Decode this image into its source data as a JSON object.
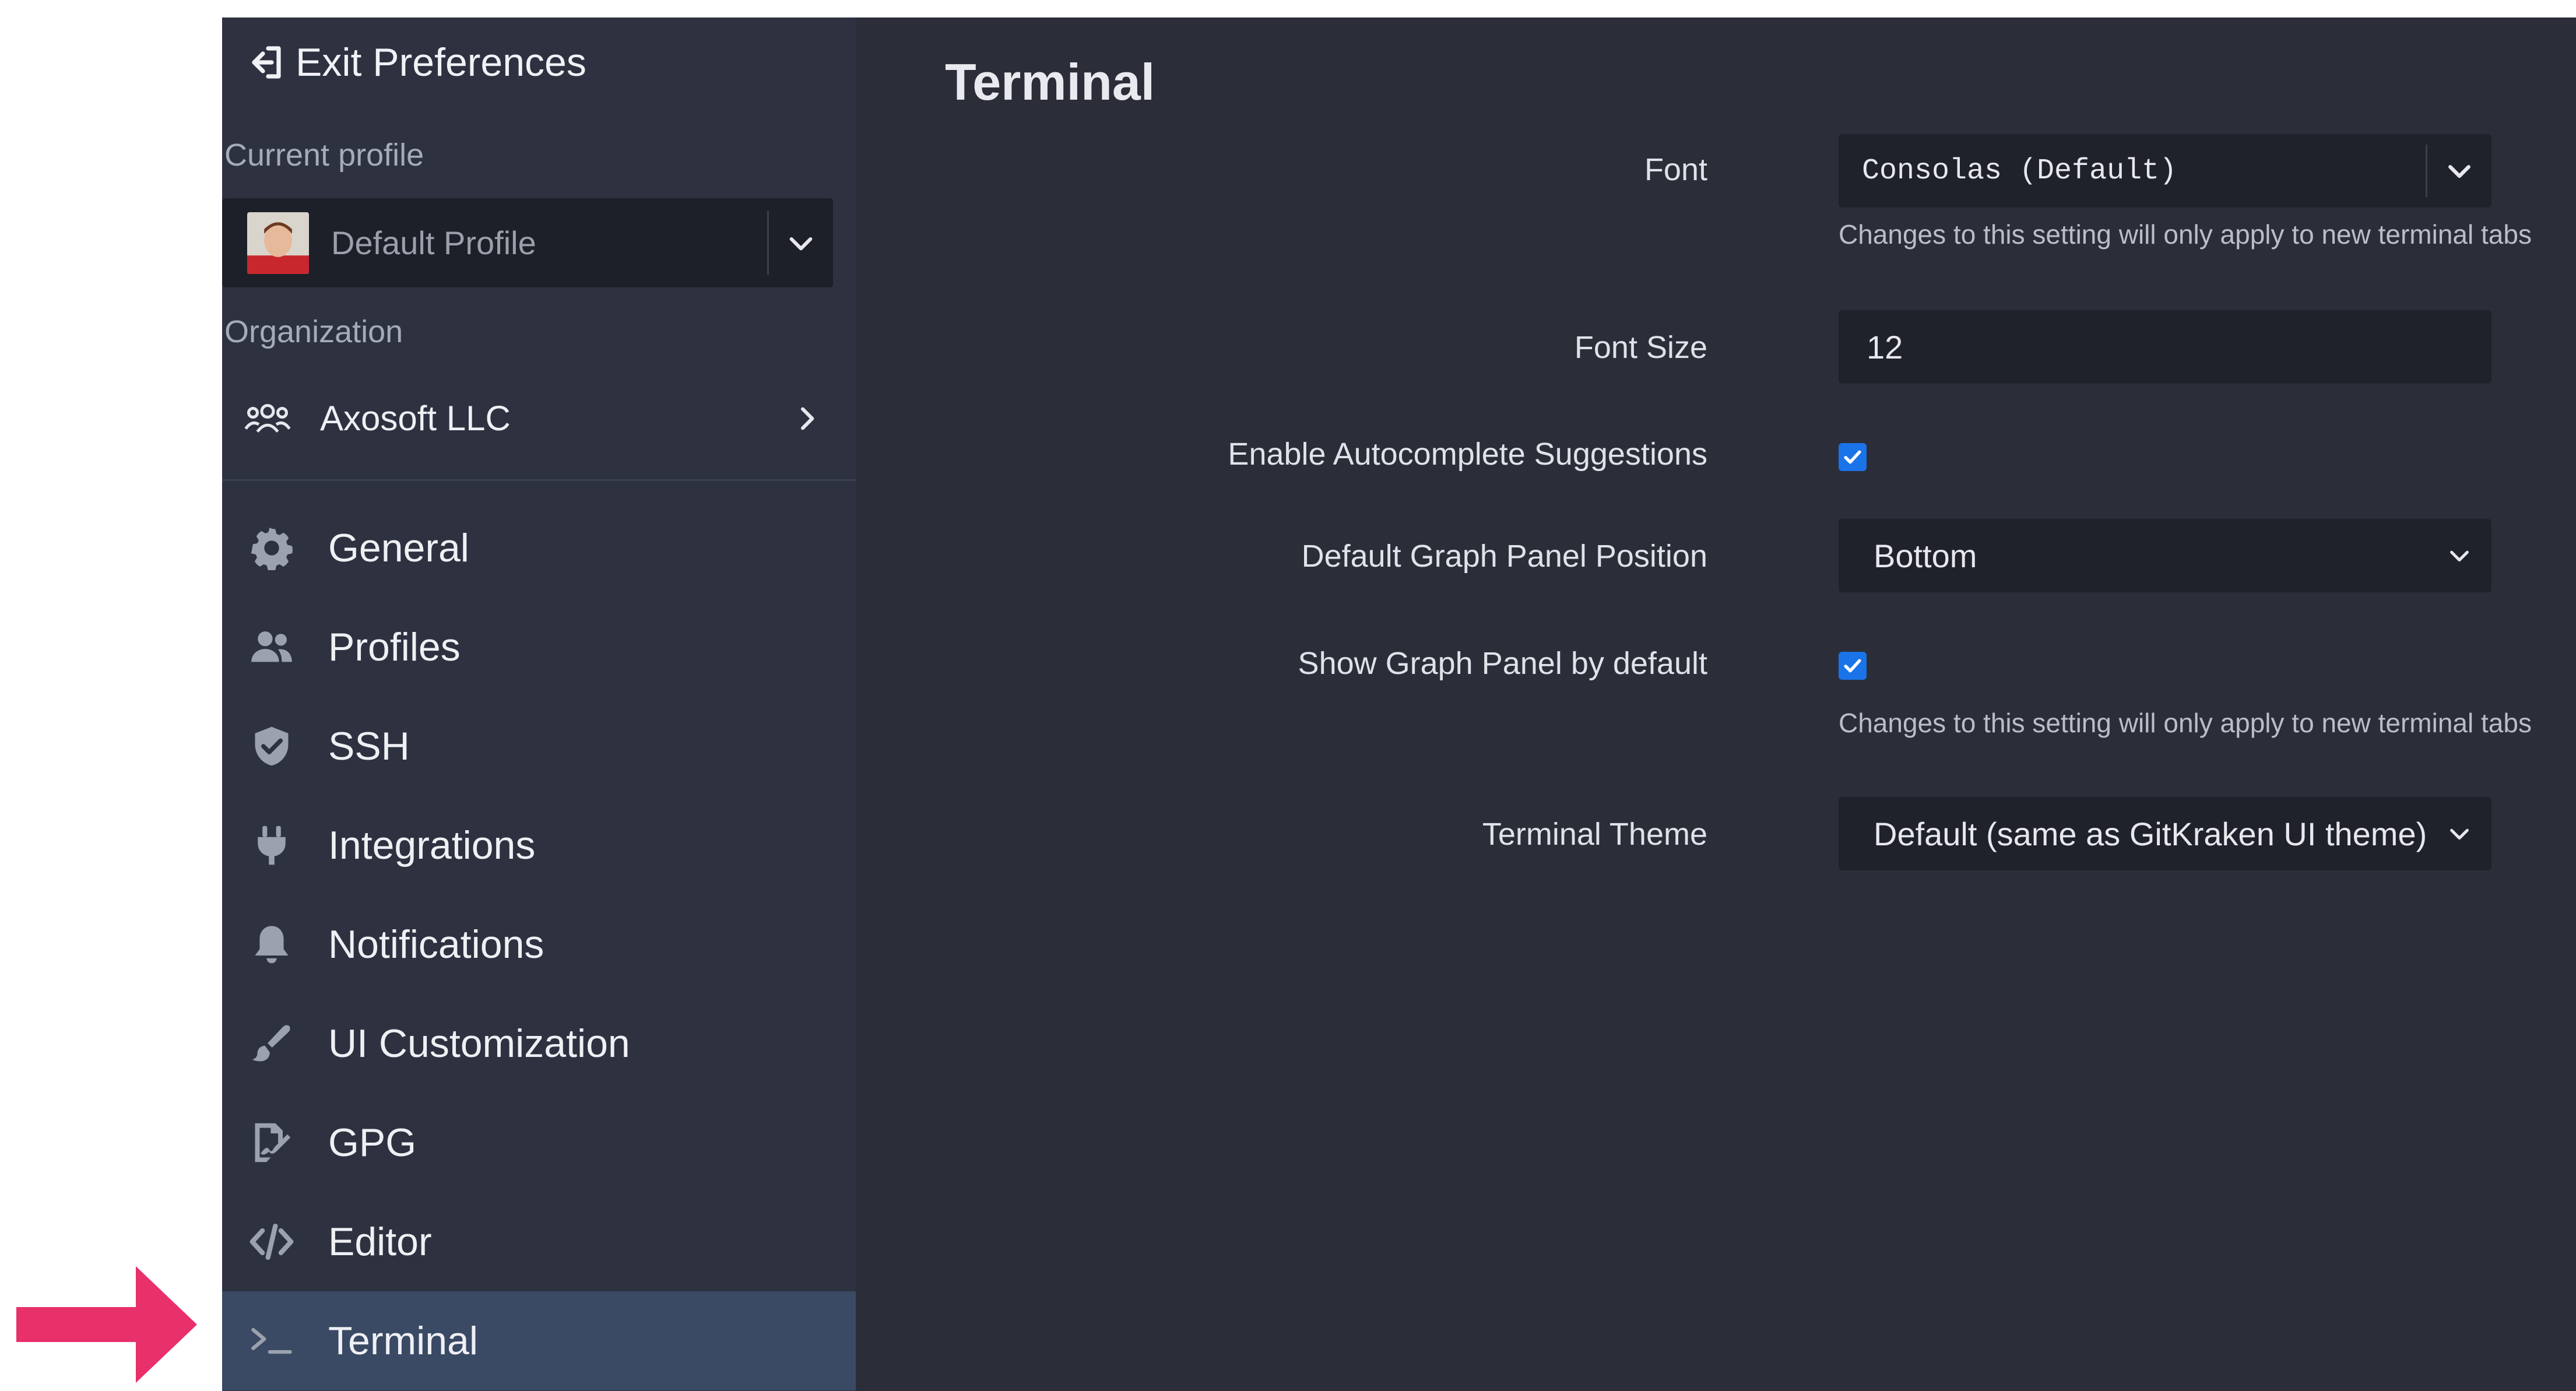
{
  "sidebar": {
    "exit_label": "Exit Preferences",
    "current_profile_label": "Current profile",
    "profile_name": "Default Profile",
    "organization_label": "Organization",
    "organization_name": "Axosoft LLC",
    "nav_items": [
      {
        "label": "General",
        "icon": "gear-icon"
      },
      {
        "label": "Profiles",
        "icon": "users-icon"
      },
      {
        "label": "SSH",
        "icon": "shield-icon"
      },
      {
        "label": "Integrations",
        "icon": "plug-icon"
      },
      {
        "label": "Notifications",
        "icon": "bell-icon"
      },
      {
        "label": "UI Customization",
        "icon": "paintbrush-icon"
      },
      {
        "label": "GPG",
        "icon": "signature-icon"
      },
      {
        "label": "Editor",
        "icon": "code-icon"
      },
      {
        "label": "Terminal",
        "icon": "terminal-icon"
      }
    ],
    "active_item": "Terminal"
  },
  "main": {
    "title": "Terminal",
    "font": {
      "label": "Font",
      "value": "Consolas (Default)",
      "hint": "Changes to this setting will only apply to new terminal tabs"
    },
    "font_size": {
      "label": "Font Size",
      "value": "12"
    },
    "autocomplete": {
      "label": "Enable Autocomplete Suggestions",
      "checked": true
    },
    "graph_position": {
      "label": "Default Graph Panel Position",
      "value": "Bottom"
    },
    "show_graph": {
      "label": "Show Graph Panel by default",
      "checked": true,
      "hint": "Changes to this setting will only apply to new terminal tabs"
    },
    "theme": {
      "label": "Terminal Theme",
      "value": "Default (same as GitKraken UI theme)"
    }
  },
  "colors": {
    "sidebar_bg": "#2e3240",
    "content_bg": "#2b2e39",
    "active_item_bg": "#3a4964",
    "checkbox_accent": "#1a73e8",
    "callout_arrow": "#e8306b"
  }
}
